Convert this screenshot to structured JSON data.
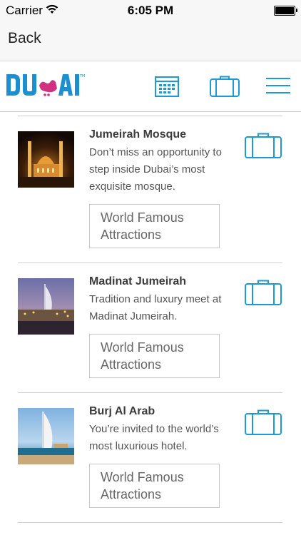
{
  "status": {
    "carrier": "Carrier",
    "time": "6:05 PM"
  },
  "nav": {
    "back_label": "Back"
  },
  "colors": {
    "accent": "#1a9bd7",
    "logo_blue": "#1b8fd0",
    "logo_pink": "#d0307f"
  },
  "attractions": [
    {
      "title": "Jumeirah Mosque",
      "description": "Don’t miss an opportunity to step inside Dubai’s most exquisite mosque.",
      "tag": "World Famous Attractions"
    },
    {
      "title": "Madinat Jumeirah",
      "description": "Tradition and luxury meet at Madinat Jumeirah.",
      "tag": "World Famous Attractions"
    },
    {
      "title": "Burj Al Arab",
      "description": "You’re invited to the world’s most luxurious hotel.",
      "tag": "World Famous Attractions"
    }
  ]
}
